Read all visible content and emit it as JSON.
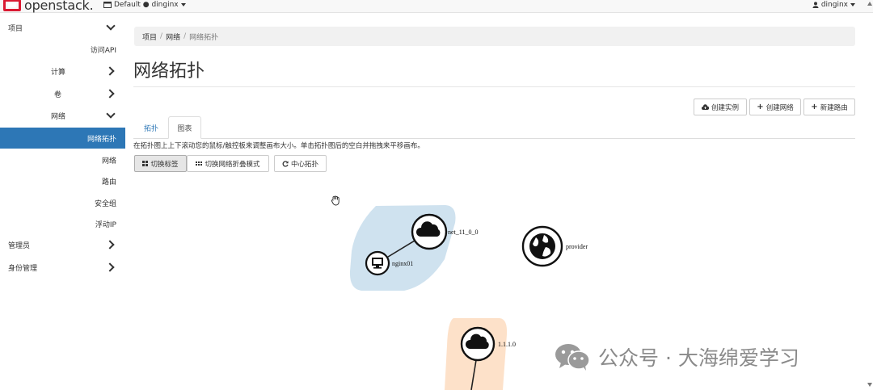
{
  "navbar": {
    "logo_text": "openstack.",
    "project_picker": "Default ● dinginx",
    "user": "dinginx"
  },
  "sidebar": {
    "items": [
      {
        "label": "项目"
      },
      {
        "label": "访问API"
      },
      {
        "label": "计算"
      },
      {
        "label": "卷"
      },
      {
        "label": "网络"
      },
      {
        "label": "网络拓扑"
      },
      {
        "label": "网络"
      },
      {
        "label": "路由"
      },
      {
        "label": "安全组"
      },
      {
        "label": "浮动IP"
      },
      {
        "label": "管理员"
      },
      {
        "label": "身份管理"
      }
    ]
  },
  "breadcrumb": [
    "项目",
    "网络",
    "网络拓扑"
  ],
  "page": {
    "title": "网络拓扑",
    "actions": {
      "create_instance": "创建实例",
      "create_network": "创建网络",
      "create_router": "新建路由"
    },
    "tabs": {
      "topology": "拓扑",
      "graph": "图表"
    },
    "hint": "在拓扑图上上下滚动您的鼠标/触控板来调整画布大小。单击拓扑图后的空白并拖拽来平移画布。",
    "controls": {
      "toggle_labels": "切换标签",
      "toggle_collapse": "切换网络折叠模式",
      "center": "中心拓扑"
    }
  },
  "topology": {
    "networks": [
      {
        "name": "net_11_0_0",
        "color": "#cfe2ef"
      },
      {
        "name": "1.1.1.0",
        "color": "#fde1c9"
      }
    ],
    "instances": [
      {
        "name": "nginx01"
      }
    ],
    "external": [
      {
        "name": "provider"
      }
    ]
  },
  "watermark": "公众号 · 大海绵爱学习",
  "colors": {
    "accent": "#2d77b6",
    "brand": "#da1a32"
  }
}
